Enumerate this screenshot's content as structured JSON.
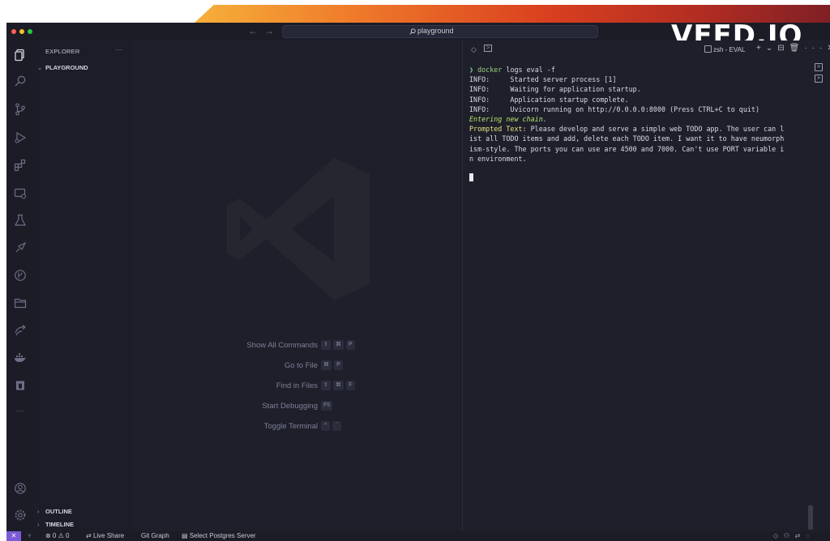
{
  "window": {
    "search": "playground",
    "watermark": "VEED.IO"
  },
  "sidebar": {
    "title": "EXPLORER",
    "more": "···",
    "folder": "PLAYGROUND",
    "outline": "OUTLINE",
    "timeline": "TIMELINE"
  },
  "activity_icons": [
    "explorer-icon",
    "search-icon",
    "source-control-icon",
    "run-debug-icon",
    "extensions-icon",
    "remote-explorer-icon",
    "testing-icon",
    "rest-client-icon",
    "git-graph-icon",
    "folder-icon",
    "live-share-icon",
    "docker-icon",
    "database-icon",
    "more-icon",
    "account-icon",
    "settings-icon"
  ],
  "welcome": {
    "shortcuts": [
      {
        "label": "Show All Commands",
        "keys": [
          "⇧",
          "⌘",
          "P"
        ]
      },
      {
        "label": "Go to File",
        "keys": [
          "⌘",
          "P"
        ]
      },
      {
        "label": "Find in Files",
        "keys": [
          "⇧",
          "⌘",
          "F"
        ]
      },
      {
        "label": "Start Debugging",
        "keys": [
          "F5"
        ]
      },
      {
        "label": "Toggle Terminal",
        "keys": [
          "^",
          "`"
        ]
      }
    ]
  },
  "panel": {
    "terminal_name": "zsh - EVAL",
    "tools": [
      "+",
      "⌄",
      "⊟",
      "🗑",
      "···",
      "✕"
    ]
  },
  "terminal": {
    "prompt": "❯",
    "command": "docker",
    "command_args": " logs eval -f",
    "lines": [
      "INFO:     Started server process [1]",
      "INFO:     Waiting for application startup.",
      "INFO:     Application startup complete.",
      "INFO:     Uvicorn running on http://0.0.0.0:8000 (Press CTRL+C to quit)"
    ],
    "chain": "Entering new chain.",
    "prompted_label": "Prompted Text:",
    "prompted_lines": [
      " Please develop and serve a simple web TODO app. The user can l",
      "ist all TODO items and add, delete each TODO item. I want it to have neumorph",
      "ism-style. The ports you can use are 4500 and 7000. Can't use PORT variable i",
      "n environment."
    ]
  },
  "status": {
    "remote": "✕",
    "problems": "⊗ 0 ⚠ 0",
    "live_share": "Live Share",
    "git_graph": "Git Graph",
    "postgres": "Select Postgres Server"
  },
  "colors": {
    "accent_remote": "#7b5cd6",
    "editor_bg": "#1e1f2b",
    "terminal_green": "#b6e36a",
    "terminal_yellow": "#e6e07a"
  }
}
